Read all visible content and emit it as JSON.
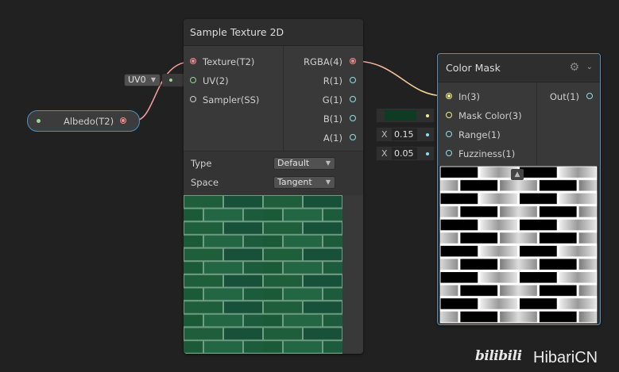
{
  "sample_node": {
    "title": "Sample Texture 2D",
    "inputs": [
      "Texture(T2)",
      "UV(2)",
      "Sampler(SS)"
    ],
    "outputs": [
      "RGBA(4)",
      "R(1)",
      "G(1)",
      "B(1)",
      "A(1)"
    ],
    "type_label": "Type",
    "type_value": "Default",
    "space_label": "Space",
    "space_value": "Tangent"
  },
  "uv_dropdown": {
    "value": "UV0"
  },
  "albedo_node": {
    "label": "Albedo(T2)"
  },
  "color_mask_node": {
    "title": "Color Mask",
    "inputs": [
      "In(3)",
      "Mask Color(3)",
      "Range(1)",
      "Fuzziness(1)"
    ],
    "output": "Out(1)",
    "range_axis": "X",
    "range_value": "0.15",
    "fuzz_axis": "X",
    "fuzz_value": "0.05",
    "mask_color": "#0d3b23"
  },
  "colors": {
    "texture_wire": "#f09a9a",
    "uv_wire": "#9ad69a",
    "vector_wire_start": "#f0a0a0",
    "vector_wire_end": "#f0ec8c",
    "accent_selection": "#4c90c4",
    "brick_green": "#1f5e3a",
    "mortar": "#6f9c82"
  },
  "watermark": {
    "logo": "bilibili",
    "text": "HibariCN"
  }
}
